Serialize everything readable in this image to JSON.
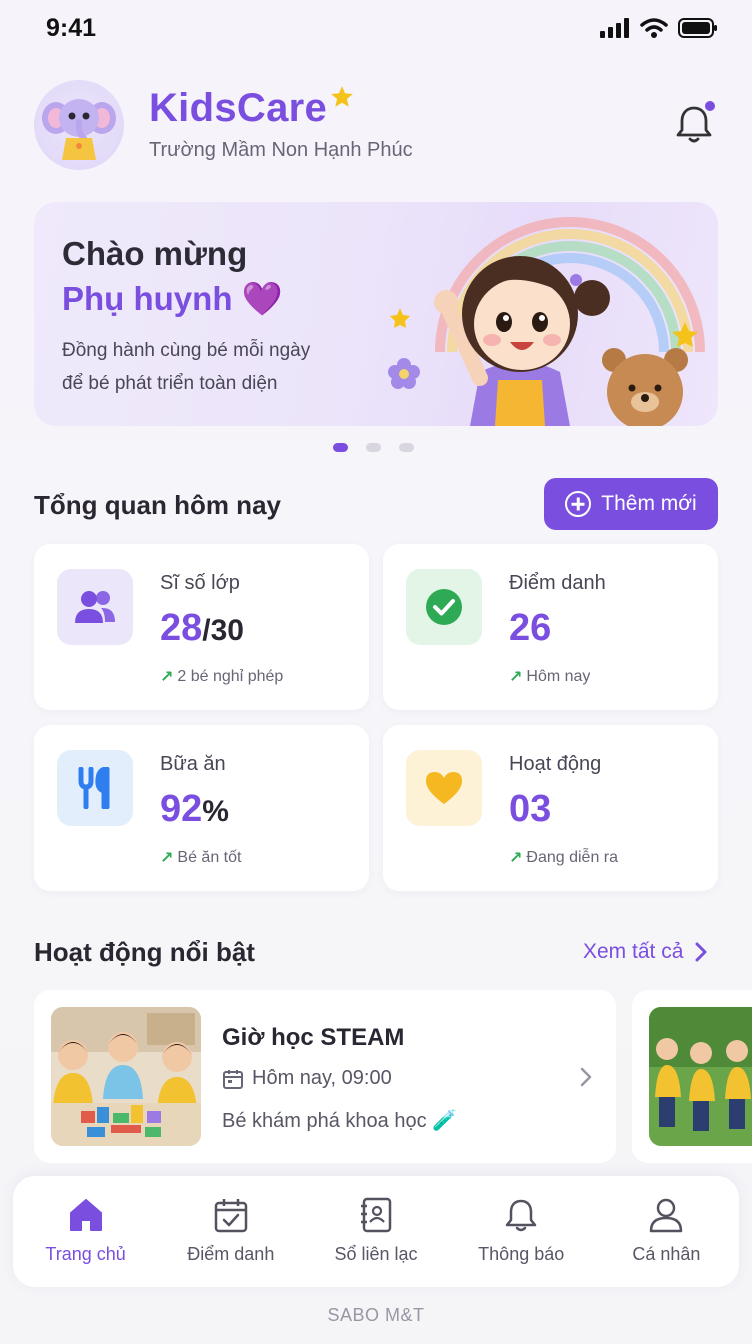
{
  "status_bar": {
    "time": "9:41"
  },
  "header": {
    "app_name": "KidsCare",
    "school_name": "Trường Mầm Non Hạnh Phúc",
    "notification_dot": true
  },
  "banner": {
    "greeting": "Chào mừng",
    "audience": "Phụ huynh 💜",
    "line1": "Đồng hành cùng bé mỗi ngày",
    "line2": "để bé phát triển toàn diện",
    "page_count": 3,
    "active_page": 1
  },
  "overview": {
    "title": "Tổng quan hôm nay",
    "add_button": "Thêm mới",
    "cards": [
      {
        "label": "Sĩ số lớp",
        "value": "28",
        "value_sub": "/30",
        "note": "2 bé nghỉ phép",
        "icon": "users-icon",
        "color": "#7a4fe0"
      },
      {
        "label": "Điểm danh",
        "value": "26",
        "value_sub": "",
        "note": "Hôm nay",
        "icon": "check-circle-icon",
        "color": "#2eaa55"
      },
      {
        "label": "Bữa ăn",
        "value": "92",
        "value_sub": "%",
        "note": "Bé ăn tốt",
        "icon": "fork-knife-icon",
        "color": "#3b82f6"
      },
      {
        "label": "Hoạt động",
        "value": "03",
        "value_sub": "",
        "note": "Đang diễn ra",
        "icon": "heart-icon",
        "color": "#f5b820"
      }
    ]
  },
  "featured": {
    "title": "Hoạt động nổi bật",
    "see_all": "Xem tất cả",
    "items": [
      {
        "name": "Giờ học STEAM",
        "time": "Hôm nay, 09:00",
        "desc": "Bé khám phá khoa học 🧪"
      }
    ]
  },
  "bottom_nav": {
    "items": [
      {
        "label": "Trang chủ",
        "icon": "home-icon",
        "active": true
      },
      {
        "label": "Điểm danh",
        "icon": "calendar-check-icon",
        "active": false
      },
      {
        "label": "Sổ liên lạc",
        "icon": "contact-book-icon",
        "active": false
      },
      {
        "label": "Thông báo",
        "icon": "bell-icon",
        "active": false
      },
      {
        "label": "Cá nhân",
        "icon": "user-icon",
        "active": false
      }
    ]
  },
  "footer": "SABO M&T",
  "colors": {
    "accent": "#7a4fe0",
    "success": "#2eaa55",
    "background": "#f6f5f9"
  }
}
